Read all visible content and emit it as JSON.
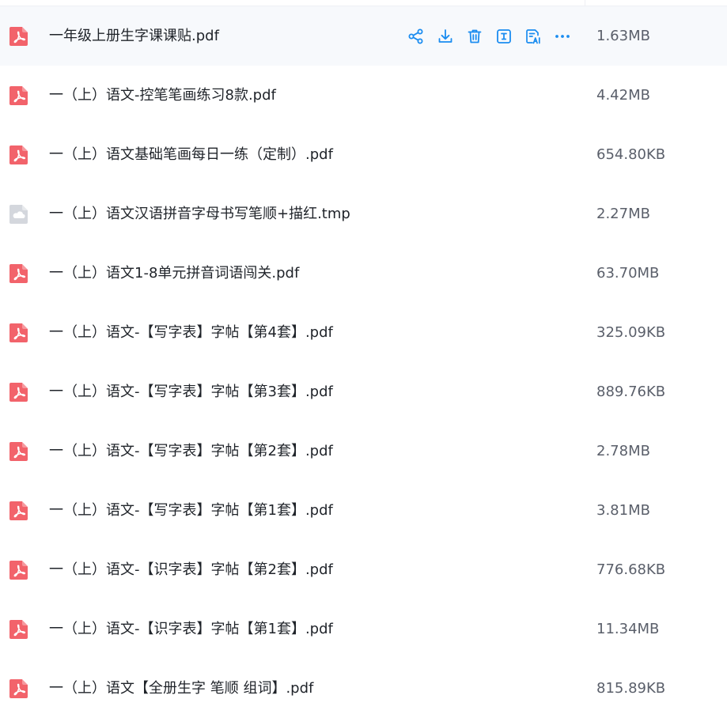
{
  "colors": {
    "accent": "#1a8cf0",
    "pdf_icon": "#f2636b",
    "tmp_icon": "#d4d7dd",
    "hover_row": "#f7f9fc"
  },
  "row_actions": [
    {
      "name": "share-icon",
      "label": "share"
    },
    {
      "name": "download-icon",
      "label": "download"
    },
    {
      "name": "delete-icon",
      "label": "delete"
    },
    {
      "name": "rename-icon",
      "label": "rename"
    },
    {
      "name": "ai-summary-icon",
      "label": "ai"
    },
    {
      "name": "more-icon",
      "label": "more"
    }
  ],
  "files": [
    {
      "name": "一年级上册生字课课贴.pdf",
      "size": "1.63MB",
      "type": "pdf-icon"
    },
    {
      "name": "一（上）语文-控笔笔画练习8款.pdf",
      "size": "4.42MB",
      "type": "pdf-icon"
    },
    {
      "name": "一（上）语文基础笔画每日一练（定制）.pdf",
      "size": "654.80KB",
      "type": "pdf-icon"
    },
    {
      "name": "一（上）语文汉语拼音字母书写笔顺+描红.tmp",
      "size": "2.27MB",
      "type": "cloud-file-icon"
    },
    {
      "name": "一（上）语文1-8单元拼音词语闯关.pdf",
      "size": "63.70MB",
      "type": "pdf-icon"
    },
    {
      "name": "一（上）语文-【写字表】字帖【第4套】.pdf",
      "size": "325.09KB",
      "type": "pdf-icon"
    },
    {
      "name": "一（上）语文-【写字表】字帖【第3套】.pdf",
      "size": "889.76KB",
      "type": "pdf-icon"
    },
    {
      "name": "一（上）语文-【写字表】字帖【第2套】.pdf",
      "size": "2.78MB",
      "type": "pdf-icon"
    },
    {
      "name": "一（上）语文-【写字表】字帖【第1套】.pdf",
      "size": "3.81MB",
      "type": "pdf-icon"
    },
    {
      "name": "一（上）语文-【识字表】字帖【第2套】.pdf",
      "size": "776.68KB",
      "type": "pdf-icon"
    },
    {
      "name": "一（上）语文-【识字表】字帖【第1套】.pdf",
      "size": "11.34MB",
      "type": "pdf-icon"
    },
    {
      "name": "一（上）语文【全册生字 笔顺 组词】.pdf",
      "size": "815.89KB",
      "type": "pdf-icon"
    }
  ]
}
